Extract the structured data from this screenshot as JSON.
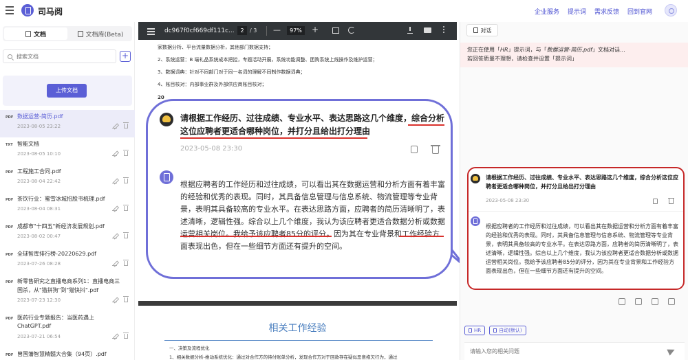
{
  "app": {
    "name": "司马阅"
  },
  "top_links": [
    "企业服务",
    "提示词",
    "需求反馈",
    "回到官网"
  ],
  "sidebar": {
    "tabs": [
      {
        "label": "文档",
        "active": true
      },
      {
        "label": "文档库(Beta)",
        "active": false
      }
    ],
    "search_placeholder": "搜索文档",
    "add_label": "+",
    "upload_label": "上传文档",
    "docs": [
      {
        "tag": "PDF",
        "title": "数据运营-简历.pdf",
        "date": "2023-08-05 23:22",
        "active": true
      },
      {
        "tag": "TXT",
        "title": "智能文档",
        "date": "2023-08-05 10:10"
      },
      {
        "tag": "PDF",
        "title": "工程施工合同.pdf",
        "date": "2023-08-04 22:42"
      },
      {
        "tag": "PDF",
        "title": "茶饮行业：蜜雪冰城招股书梳理.pdf",
        "date": "2023-08-04 08:31"
      },
      {
        "tag": "PDF",
        "title": "成都市\"十四五\"新经济发展规划.pdf",
        "date": "2023-08-02 00:47"
      },
      {
        "tag": "PDF",
        "title": "全球智库排行榜-20220629.pdf",
        "date": "2023-07-26 08:28"
      },
      {
        "tag": "PDF",
        "title": "新零售研究之直播电商系列1：直播电商三",
        "title2": "国杀，从\"猫拼狗\"到\"猫快抖\".pdf",
        "date": "2023-07-23 12:30"
      },
      {
        "tag": "PDF",
        "title": "医药行业专题报告：当医药遇上",
        "title2": "ChatGPT.pdf",
        "date": "2023-07-21 06:54"
      },
      {
        "tag": "PDF",
        "title": "曾国藩智慧精髓大合集（94页）.pdf",
        "date": ""
      }
    ]
  },
  "viewer": {
    "file_title": "dc967f0cf669df111c...",
    "page_current": "2",
    "page_total": "/ 3",
    "zoom": "97%",
    "page1_lines": [
      "家数据分析、平台流量数据分析，其他部门数据支持；",
      "2、系统运营：B 端礼品系统成本把控，专题活动开展，系统功能调整、团购系统上线操作及维护运营；",
      "3、数据词典：针对不同部门对于同一名词的理解不同制作数据词典；",
      "4、账目核对：内部事业群及外部供应商账目核对；",
      "20"
    ],
    "page2_heading": "相关工作经验",
    "page2_lines": [
      "一、决策及流程优化",
      "1、相关数据分析-推动系统优化：通过对合作方的待付账单分析，发现合作方对于回款存在疑似恶意拖欠行为，通过"
    ]
  },
  "zoom_bubble": {
    "question": "请根据工作经历、过往成绩、专业水平、表达思路这几个维度，综合分析这位应聘者更适合哪种岗位，并打分且给出打分理由",
    "time": "2023-05-08 23:30",
    "answer": "根据应聘者的工作经历和过往成绩，可以看出其在数据运营和分析方面有着丰富的经验和优秀的表现。同时，其具备信息管理与信息系统、物流管理等专业背景，表明其具备较高的专业水平。在表达思路方面，应聘者的简历清晰明了，表述清晰，逻辑性强。综合以上几个维度，我认为该应聘者更适合数据分析或数据运营相关岗位。我给予该应聘者85分的评分，因为其在专业背景和工作经验方面表现出色，但在一些细节方面还有提升的空间。"
  },
  "chat": {
    "tab_label": "对话",
    "notice_line1_a": "您正在使用「",
    "notice_prompt": "HR",
    "notice_line1_b": "」提示词，与「",
    "notice_doc": "数据运营-简历.pdf",
    "notice_line1_c": "」文档对话...",
    "notice_line2": "若回答质量不理想，请检查并设置「提示词」",
    "question": "请根据工作经历、过往成绩、专业水平、表达思路这几个维度，综合分析这位应聘者更适合哪种岗位，并打分且给出打分理由",
    "time": "2023-05-08 23:30",
    "answer": "根据应聘者的工作经历和过往成绩，可以看出其在数据运营和分析方面有着丰富的经验和优秀的表现。同时，其具备信息管理与信息系统、物流管理等专业背景，表明其具备较高的专业水平。在表达思路方面，应聘者的简历清晰明了，表述清晰，逻辑性强。综合以上几个维度，我认为该应聘者更适合数据分析或数据运营相关岗位。我给予该应聘者85分的评分，因为其在专业背景和工作经验方面表现出色，但在一些细节方面还有提升的空间。",
    "tag_hr": "HR",
    "tag_auto": "自动(默认)",
    "input_placeholder": "请输入您的相关问题"
  }
}
